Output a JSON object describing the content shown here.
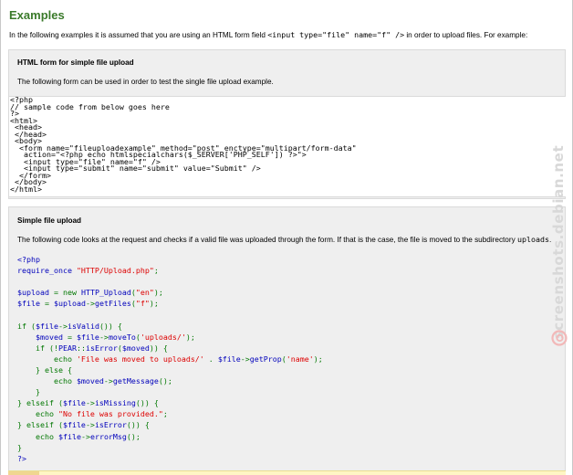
{
  "page": {
    "title": "Examples",
    "intro_before": "In the following examples it is assumed that you are using an HTML form field ",
    "intro_code": "<input type=\"file\" name=\"f\" />",
    "intro_after": " in order to upload files. For example:"
  },
  "section1": {
    "heading": "HTML form for simple file upload",
    "description": "The following form can be used in order to test the single file upload example.",
    "code": "<?php\n// sample code from below goes here\n?>\n<html>\n <head>\n </head>\n <body>\n  <form name=\"fileuploadexample\" method=\"post\" enctype=\"multipart/form-data\"\n   action=\"<?php echo htmlspecialchars($_SERVER['PHP_SELF']) ?>\">\n   <input type=\"file\" name=\"f\" />\n   <input type=\"submit\" name=\"submit\" value=\"Submit\" />\n  </form>\n </body>\n</html>"
  },
  "section2": {
    "heading": "Simple file upload",
    "description_before": "The following code looks at the request and checks if a valid file was uploaded through the form. If that is the case, the file is moved to the subdirectory ",
    "description_code": "uploads",
    "description_after": "."
  },
  "code2": {
    "lines": [
      [
        [
          "ph",
          "<?php"
        ]
      ],
      [
        [
          "ph",
          "require_once "
        ],
        [
          "str",
          "\"HTTP/Upload.php\""
        ],
        [
          "key",
          ";"
        ]
      ],
      [],
      [
        [
          "ph",
          "$upload "
        ],
        [
          "key",
          "= new "
        ],
        [
          "ph",
          "HTTP_Upload"
        ],
        [
          "key",
          "("
        ],
        [
          "str",
          "\"en\""
        ],
        [
          "key",
          ");"
        ]
      ],
      [
        [
          "ph",
          "$file "
        ],
        [
          "key",
          "= "
        ],
        [
          "ph",
          "$upload"
        ],
        [
          "key",
          "->"
        ],
        [
          "ph",
          "getFiles"
        ],
        [
          "key",
          "("
        ],
        [
          "str",
          "\"f\""
        ],
        [
          "key",
          ");"
        ]
      ],
      [],
      [
        [
          "key",
          "if ("
        ],
        [
          "ph",
          "$file"
        ],
        [
          "key",
          "->"
        ],
        [
          "ph",
          "isValid"
        ],
        [
          "key",
          "()) {"
        ]
      ],
      [
        [
          "key",
          "    "
        ],
        [
          "ph",
          "$moved "
        ],
        [
          "key",
          "= "
        ],
        [
          "ph",
          "$file"
        ],
        [
          "key",
          "->"
        ],
        [
          "ph",
          "moveTo"
        ],
        [
          "key",
          "("
        ],
        [
          "str",
          "'uploads/'"
        ],
        [
          "key",
          ");"
        ]
      ],
      [
        [
          "key",
          "    if (!"
        ],
        [
          "ph",
          "PEAR"
        ],
        [
          "key",
          "::"
        ],
        [
          "ph",
          "isError"
        ],
        [
          "key",
          "("
        ],
        [
          "ph",
          "$moved"
        ],
        [
          "key",
          ")) {"
        ]
      ],
      [
        [
          "key",
          "        echo "
        ],
        [
          "str",
          "'File was moved to uploads/'"
        ],
        [
          "key",
          " . "
        ],
        [
          "ph",
          "$file"
        ],
        [
          "key",
          "->"
        ],
        [
          "ph",
          "getProp"
        ],
        [
          "key",
          "("
        ],
        [
          "str",
          "'name'"
        ],
        [
          "key",
          ");"
        ]
      ],
      [
        [
          "key",
          "    } else {"
        ]
      ],
      [
        [
          "key",
          "        echo "
        ],
        [
          "ph",
          "$moved"
        ],
        [
          "key",
          "->"
        ],
        [
          "ph",
          "getMessage"
        ],
        [
          "key",
          "();"
        ]
      ],
      [
        [
          "key",
          "    }"
        ]
      ],
      [
        [
          "key",
          "} elseif ("
        ],
        [
          "ph",
          "$file"
        ],
        [
          "key",
          "->"
        ],
        [
          "ph",
          "isMissing"
        ],
        [
          "key",
          "()) {"
        ]
      ],
      [
        [
          "key",
          "    echo "
        ],
        [
          "str",
          "\"No file was provided.\""
        ],
        [
          "key",
          ";"
        ]
      ],
      [
        [
          "key",
          "} elseif ("
        ],
        [
          "ph",
          "$file"
        ],
        [
          "key",
          "->"
        ],
        [
          "ph",
          "isError"
        ],
        [
          "key",
          "()) {"
        ]
      ],
      [
        [
          "key",
          "    echo "
        ],
        [
          "ph",
          "$file"
        ],
        [
          "key",
          "->"
        ],
        [
          "ph",
          "errorMsg"
        ],
        [
          "key",
          "();"
        ]
      ],
      [
        [
          "key",
          "}"
        ]
      ],
      [
        [
          "ph",
          "?>"
        ]
      ]
    ]
  },
  "watermark": {
    "text": "screenshots.debian.net"
  },
  "colors": {
    "title": "#3a7a2a",
    "box_background": "#efefef",
    "php_tag": "#0000bb",
    "string": "#dd0000",
    "keyword": "#007700",
    "watermark": "#d8d8d8",
    "watermark_logo": "#f2b8b8",
    "bottom_bar": "#fff6c4"
  }
}
